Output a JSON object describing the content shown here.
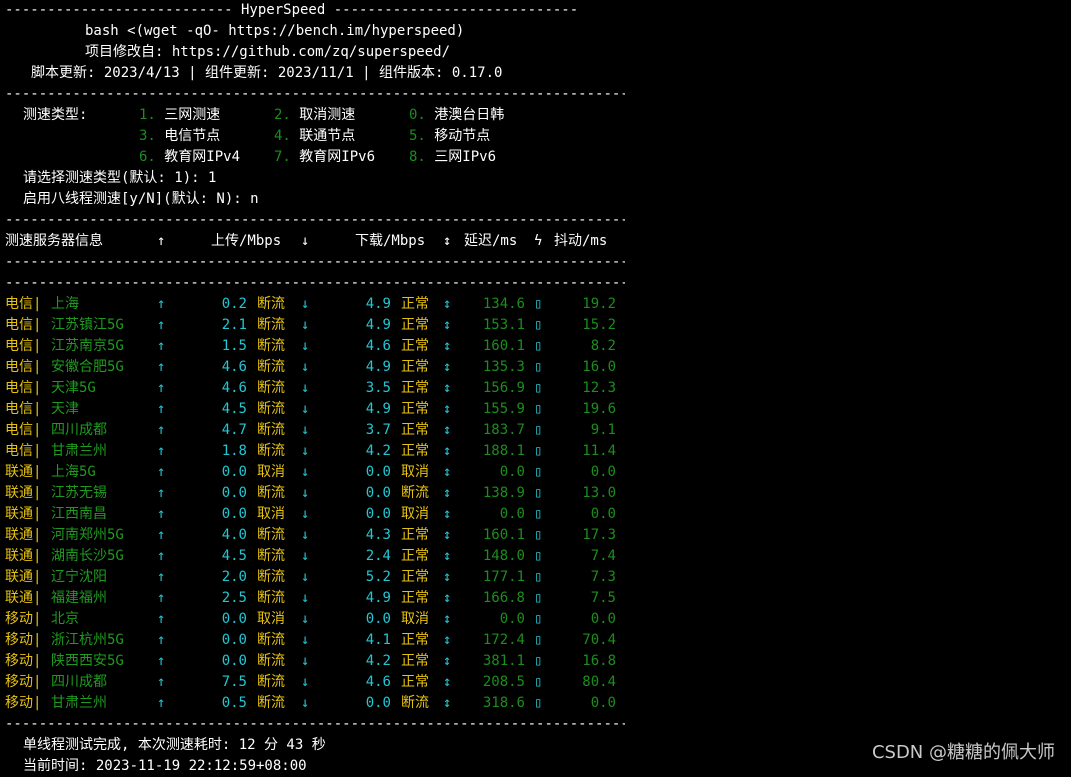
{
  "separator_line": "------------------------------------------------------------------------------------------",
  "banner": {
    "title_line": "--------------------------- HyperSpeed -----------------------------",
    "cmd": "bash <(wget -qO- https://bench.im/hyperspeed)",
    "mod": "项目修改自: https://github.com/zq/superspeed/",
    "versions": "脚本更新: 2023/4/13 | 组件更新: 2023/11/1 | 组件版本: 0.17.0"
  },
  "menu": {
    "label": "测速类型:",
    "options": [
      {
        "num": "1.",
        "label": "三网测速"
      },
      {
        "num": "2.",
        "label": "取消测速"
      },
      {
        "num": "0.",
        "label": "港澳台日韩"
      },
      {
        "num": "3.",
        "label": "电信节点"
      },
      {
        "num": "4.",
        "label": "联通节点"
      },
      {
        "num": "5.",
        "label": "移动节点"
      },
      {
        "num": "6.",
        "label": "教育网IPv4"
      },
      {
        "num": "7.",
        "label": "教育网IPv6"
      },
      {
        "num": "8.",
        "label": "三网IPv6"
      }
    ],
    "prompt_type": "请选择测速类型(默认: 1): 1",
    "prompt_threads": "启用八线程测速[y/N](默认: N): n"
  },
  "table": {
    "headers": {
      "server": "测速服务器信息",
      "up_arrow": "↑",
      "upload": "上传/Mbps",
      "down_arrow": "↓",
      "download": "下载/Mbps",
      "updown_arrow": "↕",
      "latency": "延迟/ms",
      "jitter_symbol": "ϟ",
      "jitter": "抖动/ms"
    },
    "rows": [
      {
        "isp": "电信",
        "city": "上海",
        "up_arrow": "↑",
        "up": "0.2",
        "up_status": "断流",
        "down_arrow": "↓",
        "down": "4.9",
        "down_status": "正常",
        "ud_arrow": "↕",
        "latency": "134.6",
        "box": "▯",
        "jitter": "19.2"
      },
      {
        "isp": "电信",
        "city": "江苏镇江5G",
        "up_arrow": "↑",
        "up": "2.1",
        "up_status": "断流",
        "down_arrow": "↓",
        "down": "4.9",
        "down_status": "正常",
        "ud_arrow": "↕",
        "latency": "153.1",
        "box": "▯",
        "jitter": "15.2"
      },
      {
        "isp": "电信",
        "city": "江苏南京5G",
        "up_arrow": "↑",
        "up": "1.5",
        "up_status": "断流",
        "down_arrow": "↓",
        "down": "4.6",
        "down_status": "正常",
        "ud_arrow": "↕",
        "latency": "160.1",
        "box": "▯",
        "jitter": "8.2"
      },
      {
        "isp": "电信",
        "city": "安徽合肥5G",
        "up_arrow": "↑",
        "up": "4.6",
        "up_status": "断流",
        "down_arrow": "↓",
        "down": "4.9",
        "down_status": "正常",
        "ud_arrow": "↕",
        "latency": "135.3",
        "box": "▯",
        "jitter": "16.0"
      },
      {
        "isp": "电信",
        "city": "天津5G",
        "up_arrow": "↑",
        "up": "4.6",
        "up_status": "断流",
        "down_arrow": "↓",
        "down": "3.5",
        "down_status": "正常",
        "ud_arrow": "↕",
        "latency": "156.9",
        "box": "▯",
        "jitter": "12.3"
      },
      {
        "isp": "电信",
        "city": "天津",
        "up_arrow": "↑",
        "up": "4.5",
        "up_status": "断流",
        "down_arrow": "↓",
        "down": "4.9",
        "down_status": "正常",
        "ud_arrow": "↕",
        "latency": "155.9",
        "box": "▯",
        "jitter": "19.6"
      },
      {
        "isp": "电信",
        "city": "四川成都",
        "up_arrow": "↑",
        "up": "4.7",
        "up_status": "断流",
        "down_arrow": "↓",
        "down": "3.7",
        "down_status": "正常",
        "ud_arrow": "↕",
        "latency": "183.7",
        "box": "▯",
        "jitter": "9.1"
      },
      {
        "isp": "电信",
        "city": "甘肃兰州",
        "up_arrow": "↑",
        "up": "1.8",
        "up_status": "断流",
        "down_arrow": "↓",
        "down": "4.2",
        "down_status": "正常",
        "ud_arrow": "↕",
        "latency": "188.1",
        "box": "▯",
        "jitter": "11.4"
      },
      {
        "isp": "联通",
        "city": "上海5G",
        "up_arrow": "↑",
        "up": "0.0",
        "up_status": "取消",
        "down_arrow": "↓",
        "down": "0.0",
        "down_status": "取消",
        "ud_arrow": "↕",
        "latency": "0.0",
        "box": "▯",
        "jitter": "0.0"
      },
      {
        "isp": "联通",
        "city": "江苏无锡",
        "up_arrow": "↑",
        "up": "0.0",
        "up_status": "断流",
        "down_arrow": "↓",
        "down": "0.0",
        "down_status": "断流",
        "ud_arrow": "↕",
        "latency": "138.9",
        "box": "▯",
        "jitter": "13.0"
      },
      {
        "isp": "联通",
        "city": "江西南昌",
        "up_arrow": "↑",
        "up": "0.0",
        "up_status": "取消",
        "down_arrow": "↓",
        "down": "0.0",
        "down_status": "取消",
        "ud_arrow": "↕",
        "latency": "0.0",
        "box": "▯",
        "jitter": "0.0"
      },
      {
        "isp": "联通",
        "city": "河南郑州5G",
        "up_arrow": "↑",
        "up": "4.0",
        "up_status": "断流",
        "down_arrow": "↓",
        "down": "4.3",
        "down_status": "正常",
        "ud_arrow": "↕",
        "latency": "160.1",
        "box": "▯",
        "jitter": "17.3"
      },
      {
        "isp": "联通",
        "city": "湖南长沙5G",
        "up_arrow": "↑",
        "up": "4.5",
        "up_status": "断流",
        "down_arrow": "↓",
        "down": "2.4",
        "down_status": "正常",
        "ud_arrow": "↕",
        "latency": "148.0",
        "box": "▯",
        "jitter": "7.4"
      },
      {
        "isp": "联通",
        "city": "辽宁沈阳",
        "up_arrow": "↑",
        "up": "2.0",
        "up_status": "断流",
        "down_arrow": "↓",
        "down": "5.2",
        "down_status": "正常",
        "ud_arrow": "↕",
        "latency": "177.1",
        "box": "▯",
        "jitter": "7.3"
      },
      {
        "isp": "联通",
        "city": "福建福州",
        "up_arrow": "↑",
        "up": "2.5",
        "up_status": "断流",
        "down_arrow": "↓",
        "down": "4.9",
        "down_status": "正常",
        "ud_arrow": "↕",
        "latency": "166.8",
        "box": "▯",
        "jitter": "7.5"
      },
      {
        "isp": "移动",
        "city": "北京",
        "up_arrow": "↑",
        "up": "0.0",
        "up_status": "取消",
        "down_arrow": "↓",
        "down": "0.0",
        "down_status": "取消",
        "ud_arrow": "↕",
        "latency": "0.0",
        "box": "▯",
        "jitter": "0.0"
      },
      {
        "isp": "移动",
        "city": "浙江杭州5G",
        "up_arrow": "↑",
        "up": "0.0",
        "up_status": "断流",
        "down_arrow": "↓",
        "down": "4.1",
        "down_status": "正常",
        "ud_arrow": "↕",
        "latency": "172.4",
        "box": "▯",
        "jitter": "70.4"
      },
      {
        "isp": "移动",
        "city": "陕西西安5G",
        "up_arrow": "↑",
        "up": "0.0",
        "up_status": "断流",
        "down_arrow": "↓",
        "down": "4.2",
        "down_status": "正常",
        "ud_arrow": "↕",
        "latency": "381.1",
        "box": "▯",
        "jitter": "16.8"
      },
      {
        "isp": "移动",
        "city": "四川成都",
        "up_arrow": "↑",
        "up": "7.5",
        "up_status": "断流",
        "down_arrow": "↓",
        "down": "4.6",
        "down_status": "正常",
        "ud_arrow": "↕",
        "latency": "208.5",
        "box": "▯",
        "jitter": "80.4"
      },
      {
        "isp": "移动",
        "city": "甘肃兰州",
        "up_arrow": "↑",
        "up": "0.5",
        "up_status": "断流",
        "down_arrow": "↓",
        "down": "0.0",
        "down_status": "断流",
        "ud_arrow": "↕",
        "latency": "318.6",
        "box": "▯",
        "jitter": "0.0"
      }
    ]
  },
  "footer": {
    "done": "单线程测试完成, 本次测速耗时: 12 分 43 秒",
    "time": "当前时间: 2023-11-19 22:12:59+08:00"
  },
  "watermark": "CSDN @糖糖的佩大师",
  "colors": {
    "background": "#000000",
    "text": "#ffffff",
    "green": "#1b8e1b",
    "yellow": "#e6c210",
    "cyan": "#22c7d3",
    "watermark": "#c9c9c9"
  }
}
